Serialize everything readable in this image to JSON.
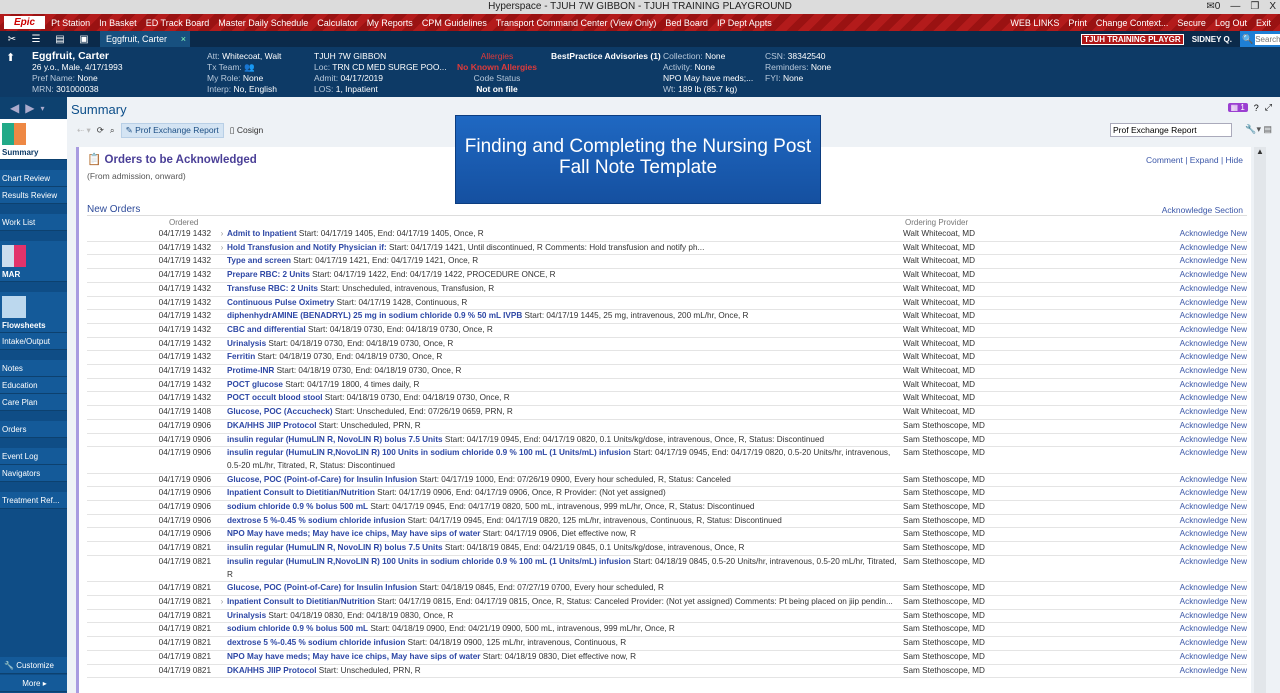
{
  "window": {
    "title": "Hyperspace - TJUH 7W GIBBON - TJUH TRAINING PLAYGROUND",
    "mail": "0"
  },
  "menubar": {
    "logo": "Epic",
    "items": [
      "Pt Station",
      "In Basket",
      "ED Track Board",
      "Master Daily Schedule",
      "Calculator",
      "My Reports",
      "CPM Guidelines",
      "Transport Command Center (View Only)",
      "Bed Board",
      "IP Dept Appts"
    ],
    "right": [
      "WEB LINKS",
      "Print",
      "Change Context...",
      "Secure",
      "Log Out",
      "Exit"
    ]
  },
  "tabbar": {
    "patient_tab": "Eggfruit, Carter",
    "env": "TJUH TRAINING PLAYGR",
    "user": "SIDNEY Q.",
    "search_placeholder": "Search"
  },
  "patient": {
    "name": "Eggfruit, Carter",
    "demo": "26 y.o., Male, 4/17/1993",
    "pref_name": "None",
    "mrn": "301000038",
    "att": "Whitecoat, Walt",
    "tx_team": "",
    "my_role": "None",
    "interp": "No, English",
    "unit": "TJUH 7W GIBBON",
    "loc": "TRN CD MED SURGE POO...",
    "admit": "04/17/2019",
    "los": "1, Inpatient",
    "allergies_label": "Allergies",
    "allergies": "No Known Allergies",
    "code_status_label": "Code Status",
    "code_status": "Not on file",
    "bpa": "BestPractice Advisories (1)",
    "collection": "None",
    "activity": "None",
    "npo": "NPO May have meds;...",
    "wt": "189 lb (85.7 kg)",
    "csn": "38342540",
    "reminders": "None",
    "fyi": "None",
    "labels": {
      "pref": "Pref Name: ",
      "mrn": "MRN: ",
      "att": "Att: ",
      "tx": "Tx Team: ",
      "role": "My Role: ",
      "interp": "Interp: ",
      "loc": "Loc: ",
      "admit": "Admit: ",
      "los": "LOS: ",
      "collection": "Collection: ",
      "activity": "Activity: ",
      "wt": "Wt: ",
      "csn": "CSN: ",
      "reminders": "Reminders: ",
      "fyi": "FYI: "
    }
  },
  "sidebar": {
    "items": [
      "Summary",
      "Chart Review",
      "Results Review",
      "Work List",
      "MAR",
      "Flowsheets",
      "Intake/Output",
      "Notes",
      "Education",
      "Care Plan",
      "Orders",
      "Event Log",
      "Navigators",
      "Treatment Ref...",
      "Customize",
      "More"
    ]
  },
  "activity": {
    "title": "Summary",
    "toolbar": {
      "prof_exchange": "Prof Exchange Report",
      "cosign": "Cosign"
    },
    "badge": "1",
    "search_value": "Prof Exchange Report"
  },
  "panel": {
    "title": "Orders to be Acknowledged",
    "subtitle": "(From admission, onward)",
    "links": "Comment | Expand | Hide",
    "section": "New Orders",
    "ack_section": "Acknowledge Section",
    "col_ordered": "Ordered",
    "col_provider": "Ordering Provider",
    "ack_label": "Acknowledge New"
  },
  "overlay": {
    "text": "Finding and Completing the Nursing Post Fall Note Template"
  },
  "orders": [
    {
      "dt": "04/17/19 1432",
      "exp": true,
      "name": "Admit to Inpatient",
      "detail": "Start: 04/17/19 1405, End: 04/17/19 1405, Once, R",
      "prov": "Walt Whitecoat, MD"
    },
    {
      "dt": "04/17/19 1432",
      "exp": true,
      "name": "Hold Transfusion and Notify Physician if:",
      "detail": "Start: 04/17/19 1421, Until discontinued, R   Comments: Hold transfusion and notify ph...",
      "prov": "Walt Whitecoat, MD"
    },
    {
      "dt": "04/17/19 1432",
      "name": "Type and screen",
      "detail": "Start: 04/17/19 1421, End: 04/17/19 1421, Once, R",
      "prov": "Walt Whitecoat, MD"
    },
    {
      "dt": "04/17/19 1432",
      "name": "Prepare RBC: 2 Units",
      "detail": "Start: 04/17/19 1422, End: 04/17/19 1422, PROCEDURE ONCE, R",
      "prov": "Walt Whitecoat, MD"
    },
    {
      "dt": "04/17/19 1432",
      "name": "Transfuse RBC: 2 Units",
      "detail": "Start: Unscheduled, intravenous, Transfusion, R",
      "prov": "Walt Whitecoat, MD"
    },
    {
      "dt": "04/17/19 1432",
      "name": "Continuous Pulse Oximetry",
      "detail": "Start: 04/17/19 1428, Continuous, R",
      "prov": "Walt Whitecoat, MD"
    },
    {
      "dt": "04/17/19 1432",
      "name": "diphenhydrAMINE (BENADRYL) 25 mg in sodium chloride 0.9 % 50 mL IVPB",
      "detail": "Start: 04/17/19 1445, 25 mg, intravenous, 200 mL/hr, Once, R",
      "prov": "Walt Whitecoat, MD"
    },
    {
      "dt": "04/17/19 1432",
      "name": "CBC and differential",
      "detail": "Start: 04/18/19 0730, End: 04/18/19 0730, Once, R",
      "prov": "Walt Whitecoat, MD"
    },
    {
      "dt": "04/17/19 1432",
      "name": "Urinalysis",
      "detail": "Start: 04/18/19 0730, End: 04/18/19 0730, Once, R",
      "prov": "Walt Whitecoat, MD"
    },
    {
      "dt": "04/17/19 1432",
      "name": "Ferritin",
      "detail": "Start: 04/18/19 0730, End: 04/18/19 0730, Once, R",
      "prov": "Walt Whitecoat, MD"
    },
    {
      "dt": "04/17/19 1432",
      "name": "Protime-INR",
      "detail": "Start: 04/18/19 0730, End: 04/18/19 0730, Once, R",
      "prov": "Walt Whitecoat, MD"
    },
    {
      "dt": "04/17/19 1432",
      "name": "POCT glucose",
      "detail": "Start: 04/17/19 1800, 4 times daily, R",
      "prov": "Walt Whitecoat, MD"
    },
    {
      "dt": "04/17/19 1432",
      "name": "POCT occult blood stool",
      "detail": "Start: 04/18/19 0730, End: 04/18/19 0730, Once, R",
      "prov": "Walt Whitecoat, MD"
    },
    {
      "dt": "04/17/19 1408",
      "name": "Glucose, POC (Accucheck)",
      "detail": "Start: Unscheduled, End: 07/26/19 0659, PRN, R",
      "prov": "Walt Whitecoat, MD"
    },
    {
      "dt": "04/17/19 0906",
      "name": "DKA/HHS JIIP Protocol",
      "detail": "Start: Unscheduled, PRN, R",
      "prov": "Sam Stethoscope, MD"
    },
    {
      "dt": "04/17/19 0906",
      "name": "insulin regular (HumuLIN R, NovoLIN R) bolus 7.5 Units",
      "detail": "Start: 04/17/19 0945, End: 04/17/19 0820, 0.1 Units/kg/dose, intravenous, Once, R, Status: Discontinued",
      "prov": "Sam Stethoscope, MD"
    },
    {
      "dt": "04/17/19 0906",
      "name": "insulin regular (HumuLIN R,NovoLIN R) 100 Units in sodium chloride 0.9 % 100 mL (1 Units/mL) infusion",
      "detail": "Start: 04/17/19 0945, End: 04/17/19 0820, 0.5-20 Units/hr, intravenous, 0.5-20 mL/hr, Titrated, R, Status: Discontinued",
      "prov": "Sam Stethoscope, MD"
    },
    {
      "dt": "04/17/19 0906",
      "name": "Glucose, POC (Point-of-Care) for Insulin Infusion",
      "detail": "Start: 04/17/19 1000, End: 07/26/19 0900, Every hour scheduled, R, Status: Canceled",
      "prov": "Sam Stethoscope, MD"
    },
    {
      "dt": "04/17/19 0906",
      "name": "Inpatient Consult to Dietitian/Nutrition",
      "detail": "Start: 04/17/19 0906, End: 04/17/19 0906, Once, R   Provider: (Not yet assigned)",
      "prov": "Sam Stethoscope, MD"
    },
    {
      "dt": "04/17/19 0906",
      "name": "sodium chloride 0.9 % bolus 500 mL",
      "detail": "Start: 04/17/19 0945, End: 04/17/19 0820, 500 mL, intravenous, 999 mL/hr, Once, R, Status: Discontinued",
      "prov": "Sam Stethoscope, MD"
    },
    {
      "dt": "04/17/19 0906",
      "name": "dextrose 5 %-0.45 % sodium chloride infusion",
      "detail": "Start: 04/17/19 0945, End: 04/17/19 0820, 125 mL/hr, intravenous, Continuous, R, Status: Discontinued",
      "prov": "Sam Stethoscope, MD"
    },
    {
      "dt": "04/17/19 0906",
      "name": "NPO May have meds; May have ice chips, May have sips of water",
      "detail": "Start: 04/17/19 0906, Diet effective now, R",
      "prov": "Sam Stethoscope, MD"
    },
    {
      "dt": "04/17/19 0821",
      "name": "insulin regular (HumuLIN R, NovoLIN R) bolus 7.5 Units",
      "detail": "Start: 04/18/19 0845, End: 04/21/19 0845, 0.1 Units/kg/dose, intravenous, Once, R",
      "prov": "Sam Stethoscope, MD"
    },
    {
      "dt": "04/17/19 0821",
      "name": "insulin regular (HumuLIN R,NovoLIN R) 100 Units in sodium chloride 0.9 % 100 mL (1 Units/mL) infusion",
      "detail": "Start: 04/18/19 0845, 0.5-20 Units/hr, intravenous, 0.5-20 mL/hr, Titrated, R",
      "prov": "Sam Stethoscope, MD"
    },
    {
      "dt": "04/17/19 0821",
      "name": "Glucose, POC (Point-of-Care) for Insulin Infusion",
      "detail": "Start: 04/18/19 0845, End: 07/27/19 0700, Every hour scheduled, R",
      "prov": "Sam Stethoscope, MD"
    },
    {
      "dt": "04/17/19 0821",
      "exp": true,
      "name": "Inpatient Consult to Dietitian/Nutrition",
      "detail": "Start: 04/17/19 0815, End: 04/17/19 0815, Once, R, Status: Canceled   Provider: (Not yet assigned) Comments: Pt being placed on jiip pendin...",
      "prov": "Sam Stethoscope, MD"
    },
    {
      "dt": "04/17/19 0821",
      "name": "Urinalysis",
      "detail": "Start: 04/18/19 0830, End: 04/18/19 0830, Once, R",
      "prov": "Sam Stethoscope, MD"
    },
    {
      "dt": "04/17/19 0821",
      "name": "sodium chloride 0.9 % bolus 500 mL",
      "detail": "Start: 04/18/19 0900, End: 04/21/19 0900, 500 mL, intravenous, 999 mL/hr, Once, R",
      "prov": "Sam Stethoscope, MD"
    },
    {
      "dt": "04/17/19 0821",
      "name": "dextrose 5 %-0.45 % sodium chloride infusion",
      "detail": "Start: 04/18/19 0900, 125 mL/hr, intravenous, Continuous, R",
      "prov": "Sam Stethoscope, MD"
    },
    {
      "dt": "04/17/19 0821",
      "name": "NPO May have meds; May have ice chips, May have sips of water",
      "detail": "Start: 04/18/19 0830, Diet effective now, R",
      "prov": "Sam Stethoscope, MD"
    },
    {
      "dt": "04/17/19 0821",
      "name": "DKA/HHS JIIP Protocol",
      "detail": "Start: Unscheduled, PRN, R",
      "prov": "Sam Stethoscope, MD"
    }
  ]
}
